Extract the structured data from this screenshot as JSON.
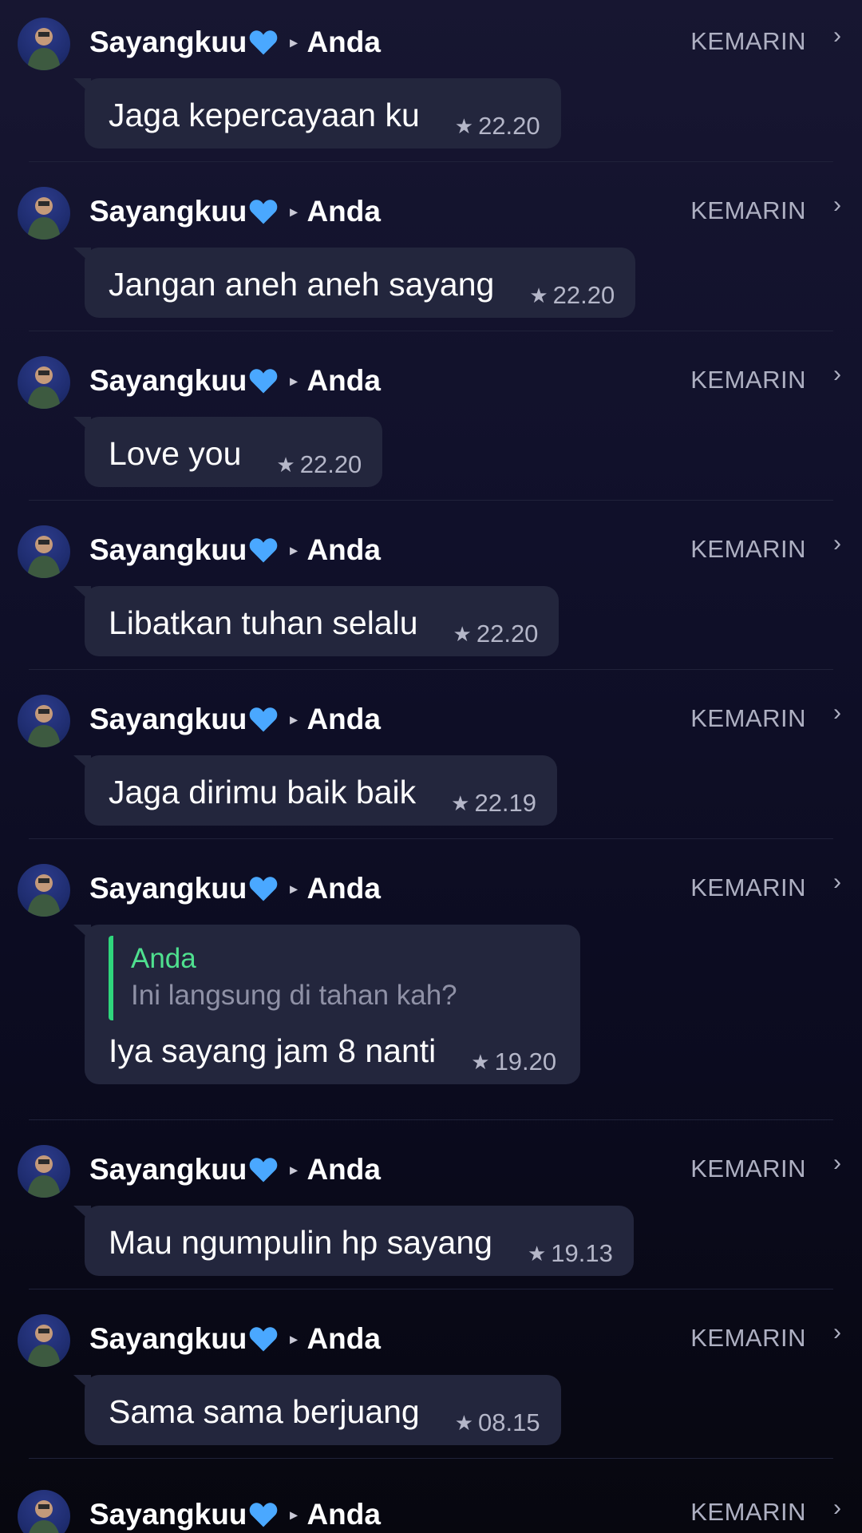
{
  "sender": "Sayangkuu",
  "recipient": "Anda",
  "day_label": "KEMARIN",
  "icons": {
    "heart": "blue-heart-icon",
    "arrow": "right-triangle-icon",
    "chevron": "chevron-right-icon",
    "star": "star-icon"
  },
  "colors": {
    "bubble": "#23263d",
    "quote_bar": "#2fd67c",
    "quote_name": "#4fe08f",
    "heart": "#4aa8ff"
  },
  "messages": [
    {
      "text": "Jaga kepercayaan ku",
      "time": "22.20"
    },
    {
      "text": "Jangan aneh aneh sayang",
      "time": "22.20"
    },
    {
      "text": "Love you",
      "time": "22.20"
    },
    {
      "text": "Libatkan tuhan selalu",
      "time": "22.20"
    },
    {
      "text": "Jaga dirimu baik baik",
      "time": "22.19"
    },
    {
      "text": "Iya sayang jam 8 nanti",
      "time": "19.20",
      "quote": {
        "name": "Anda",
        "text": "Ini langsung di tahan kah?"
      }
    },
    {
      "text": "Mau ngumpulin hp sayang",
      "time": "19.13"
    },
    {
      "text": "Sama sama berjuang",
      "time": "08.15"
    },
    {
      "text": "",
      "time": ""
    }
  ]
}
